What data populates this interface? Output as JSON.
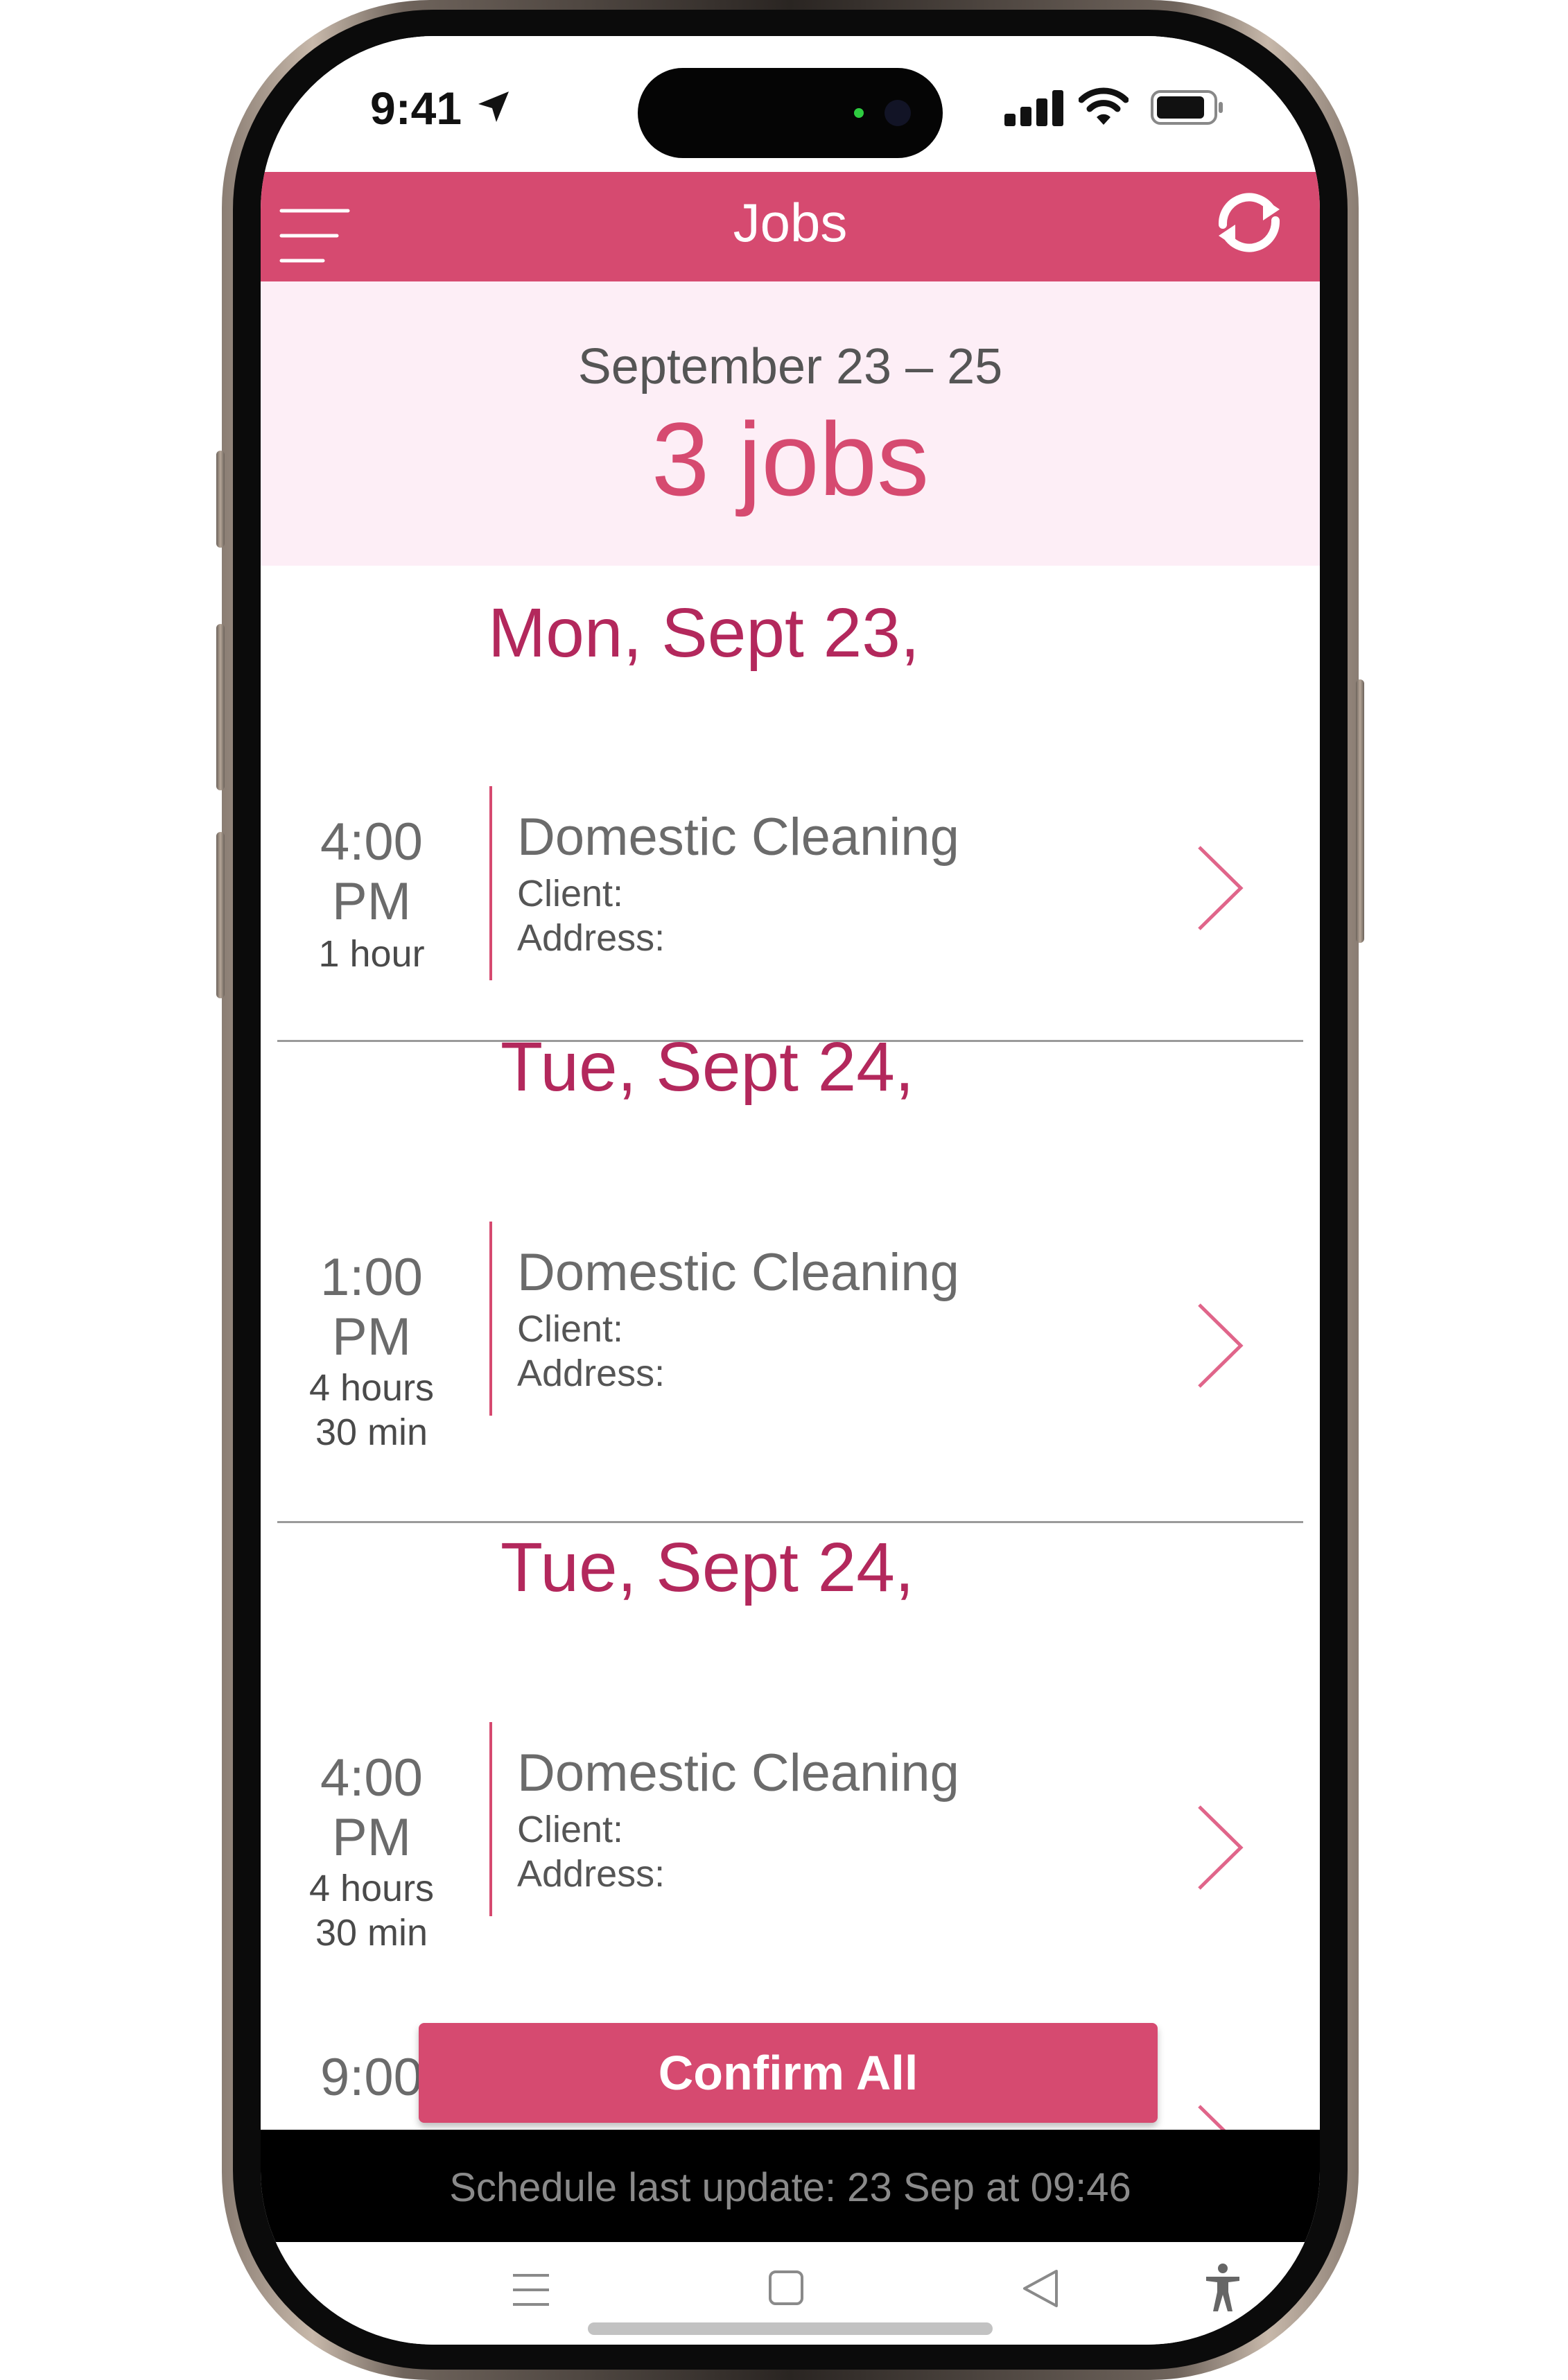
{
  "status_bar": {
    "time": "9:41"
  },
  "header": {
    "title": "Jobs"
  },
  "summary": {
    "date_range": "September 23 – 25",
    "job_count": "3 jobs"
  },
  "jobs": [
    {
      "day": "Mon, Sept 23,",
      "time_line1": "4:00",
      "time_line2": "PM",
      "duration_line1": "1 hour",
      "duration_line2": "",
      "service": "Domestic Cleaning",
      "client_label": "Client:",
      "address_label": "Address:"
    },
    {
      "day": "Tue, Sept 24,",
      "time_line1": "1:00",
      "time_line2": "PM",
      "duration_line1": "4 hours",
      "duration_line2": "30 min",
      "service": "Domestic Cleaning",
      "client_label": "Client:",
      "address_label": "Address:"
    },
    {
      "day": "Tue, Sept 24,",
      "time_line1": "4:00",
      "time_line2": "PM",
      "duration_line1": "4 hours",
      "duration_line2": "30 min",
      "service": "Domestic Cleaning",
      "client_label": "Client:",
      "address_label": "Address:"
    },
    {
      "time_line1": "9:00"
    }
  ],
  "actions": {
    "confirm_all": "Confirm All"
  },
  "footer": {
    "last_update": "Schedule last update: 23 Sep at 09:46"
  },
  "colors": {
    "brand": "#d64a70",
    "day_heading": "#b3285c",
    "summary_bg": "#fdeef6",
    "footer_bg": "#000000"
  },
  "icons": {
    "menu": "menu-icon",
    "sync": "sync-icon",
    "chevron": "chevron-right-icon",
    "nav_menu": "nav-menu-icon",
    "nav_home": "nav-home-icon",
    "nav_back": "nav-back-icon",
    "accessibility": "accessibility-icon"
  }
}
